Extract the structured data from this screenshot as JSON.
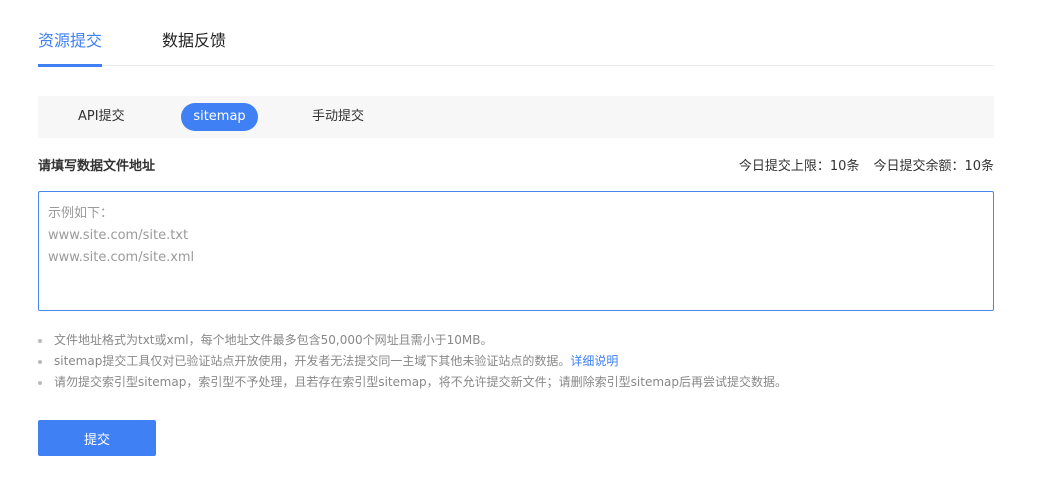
{
  "top_tabs": {
    "items": [
      {
        "label": "资源提交",
        "active": true
      },
      {
        "label": "数据反馈",
        "active": false
      }
    ]
  },
  "sub_tabs": {
    "items": [
      {
        "label": "API提交",
        "active": false
      },
      {
        "label": "sitemap",
        "active": true
      },
      {
        "label": "手动提交",
        "active": false
      }
    ]
  },
  "form": {
    "label": "请填写数据文件地址",
    "quota_limit": "今日提交上限：10条",
    "quota_remaining": "今日提交余额：10条",
    "placeholder": "示例如下：\nwww.site.com/site.txt\nwww.site.com/site.xml",
    "value": ""
  },
  "notes": {
    "items": [
      "文件地址格式为txt或xml，每个地址文件最多包含50,000个网址且需小于10MB。",
      "sitemap提交工具仅对已验证站点开放使用，开发者无法提交同一主域下其他未验证站点的数据。",
      "请勿提交索引型sitemap，索引型不予处理，且若存在索引型sitemap，将不允许提交新文件；请删除索引型sitemap后再尝试提交数据。"
    ],
    "detail_link": "详细说明"
  },
  "submit_label": "提交",
  "colors": {
    "accent": "#3f80f5",
    "tab_bg": "#f7f7f7",
    "note_text": "#888888"
  }
}
